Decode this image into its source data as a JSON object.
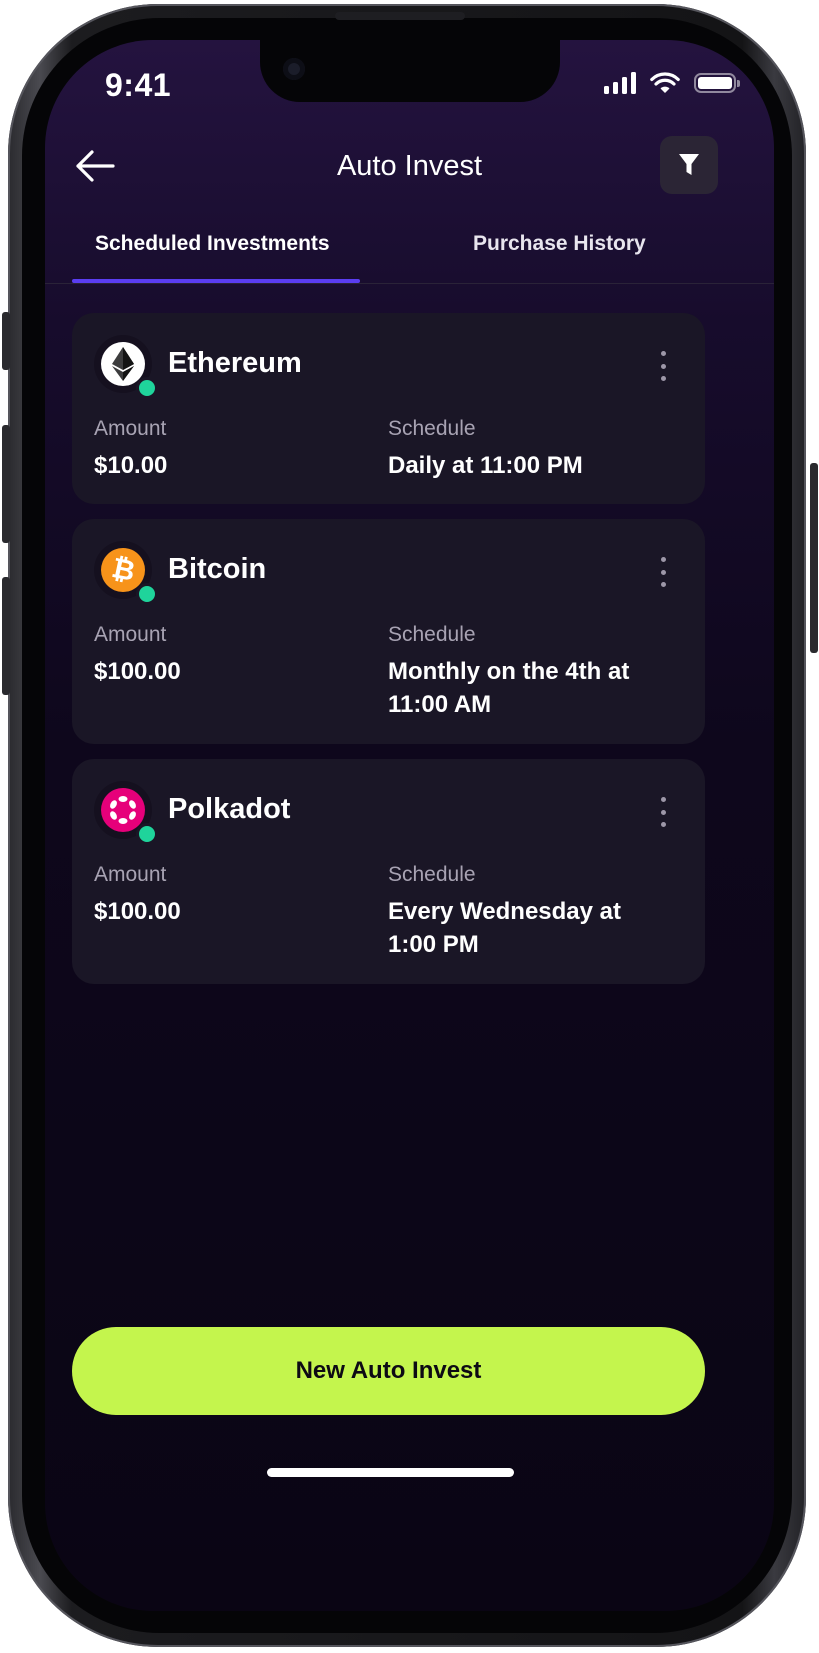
{
  "status_bar": {
    "time": "9:41"
  },
  "header": {
    "title": "Auto Invest"
  },
  "tabs": [
    {
      "label": "Scheduled Investments",
      "active": true
    },
    {
      "label": "Purchase History",
      "active": false
    }
  ],
  "investments": [
    {
      "coin": "Ethereum",
      "icon": "ethereum-icon",
      "color": "#ffffff",
      "amount_label": "Amount",
      "amount": "$10.00",
      "schedule_label": "Schedule",
      "schedule": "Daily at 11:00 PM"
    },
    {
      "coin": "Bitcoin",
      "icon": "bitcoin-icon",
      "color": "#f7931a",
      "amount_label": "Amount",
      "amount": "$100.00",
      "schedule_label": "Schedule",
      "schedule": "Monthly on the 4th at 11:00 AM"
    },
    {
      "coin": "Polkadot",
      "icon": "polkadot-icon",
      "color": "#e6007a",
      "amount_label": "Amount",
      "amount": "$100.00",
      "schedule_label": "Schedule",
      "schedule": "Every Wednesday at 1:00 PM"
    }
  ],
  "cta": {
    "label": "New Auto Invest"
  },
  "colors": {
    "accent": "#c4f54d",
    "tab_indicator": "#5a3df0",
    "status_active": "#1fd49b"
  }
}
